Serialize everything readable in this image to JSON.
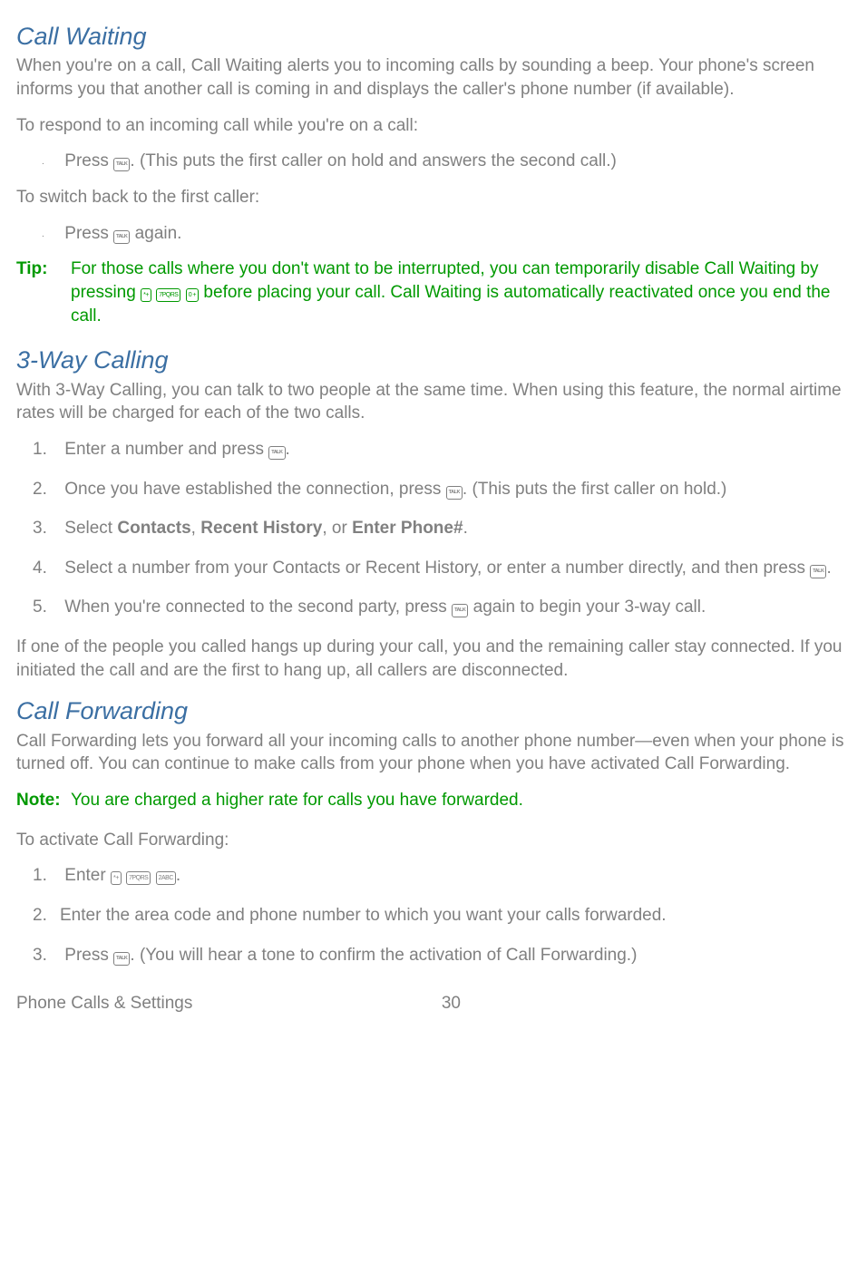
{
  "icons": {
    "talk": "TALK",
    "star": "*+",
    "seven": "7PQRS",
    "zero": "0 +",
    "two": "2ABC"
  },
  "cw": {
    "heading": "Call Waiting",
    "intro": "When you're on a call, Call Waiting alerts you to incoming calls by sounding a beep. Your phone's screen informs you that another call is coming in and displays the caller's phone number (if available).",
    "respond_label": "To respond to an incoming call while you're on a call:",
    "respond_step_pre": "Press ",
    "respond_step_post": ". (This puts the first caller on hold and answers the second call.)",
    "switch_label": "To switch back to the first caller:",
    "switch_step_pre": "Press ",
    "switch_step_post": " again.",
    "tip_label": "Tip:",
    "tip_pre": "For those calls where you don't want to be interrupted, you can temporarily disable Call Waiting by pressing ",
    "tip_post": " before placing your call. Call Waiting is automatically reactivated once you end the call."
  },
  "tw": {
    "heading": "3-Way Calling",
    "intro": "With 3-Way Calling, you can talk to two people at the same time. When using this feature, the normal airtime rates will be charged for each of the two calls.",
    "s1_pre": "Enter a number and press ",
    "s1_post": ".",
    "s2_pre": "Once you have established the connection, press ",
    "s2_post": ". (This puts the first caller on hold.)",
    "s3_pre": "Select ",
    "s3_b1": "Contacts",
    "s3_m1": ", ",
    "s3_b2": "Recent History",
    "s3_m2": ", or ",
    "s3_b3": "Enter Phone#",
    "s3_post": ".",
    "s4_pre": "Select a number from your Contacts or Recent History, or enter a number directly, and then press ",
    "s4_post": ".",
    "s5_pre": "When you're connected to the second party, press ",
    "s5_post": " again to begin your 3-way call.",
    "outro": "If one of the people you called hangs up during your call, you and the remaining caller stay connected. If you initiated the call and are the first to hang up, all callers are disconnected."
  },
  "cf": {
    "heading": "Call Forwarding",
    "intro": "Call Forwarding lets you forward all your incoming calls to another phone number—even when your phone is turned off. You can continue to make calls from your phone when you have activated Call Forwarding.",
    "note_label": "Note:",
    "note_text": "You are charged a higher rate for calls you have forwarded.",
    "activate_label": "To activate Call Forwarding:",
    "s1_pre": "Enter ",
    "s1_post": ".",
    "s2": "Enter the area code and phone number to which you want your calls forwarded.",
    "s3_pre": "Press ",
    "s3_post": ". (You will hear a tone to confirm the activation of Call Forwarding.)"
  },
  "footer": {
    "section": "Phone Calls & Settings",
    "page": "30"
  }
}
